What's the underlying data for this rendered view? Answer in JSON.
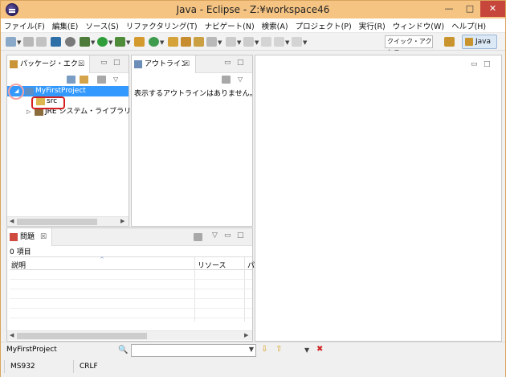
{
  "window": {
    "title": "Java - Eclipse - Z:¥workspace46",
    "minimize": "—",
    "maximize": "□",
    "close": "✕"
  },
  "menu": [
    "ファイル(F)",
    "編集(E)",
    "ソース(S)",
    "リファクタリング(T)",
    "ナビゲート(N)",
    "検索(A)",
    "プロジェクト(P)",
    "実行(R)",
    "ウィンドウ(W)",
    "ヘルプ(H)"
  ],
  "toolbar": {
    "quick_access": "クイック・アクセス",
    "perspective": "Java"
  },
  "package_explorer": {
    "tab": "パッケージ・エク...",
    "close": "☒",
    "tree": [
      {
        "label": "MyFirstProject",
        "twisty": "◢",
        "selected": true
      },
      {
        "label": "src",
        "twisty": "",
        "selected": false
      },
      {
        "label": "JRE システム・ライブラリー [J",
        "twisty": "▷",
        "selected": false
      }
    ]
  },
  "outline": {
    "tab": "アウトライン",
    "close": "☒",
    "message": "表示するアウトラインはありません。"
  },
  "problems": {
    "tab": "問題",
    "close": "☒",
    "count": "0 項目",
    "columns": [
      "説明",
      "リソース",
      "パ"
    ]
  },
  "status": {
    "selection": "MyFirstProject",
    "encoding": "MS932",
    "line_ending": "CRLF"
  }
}
